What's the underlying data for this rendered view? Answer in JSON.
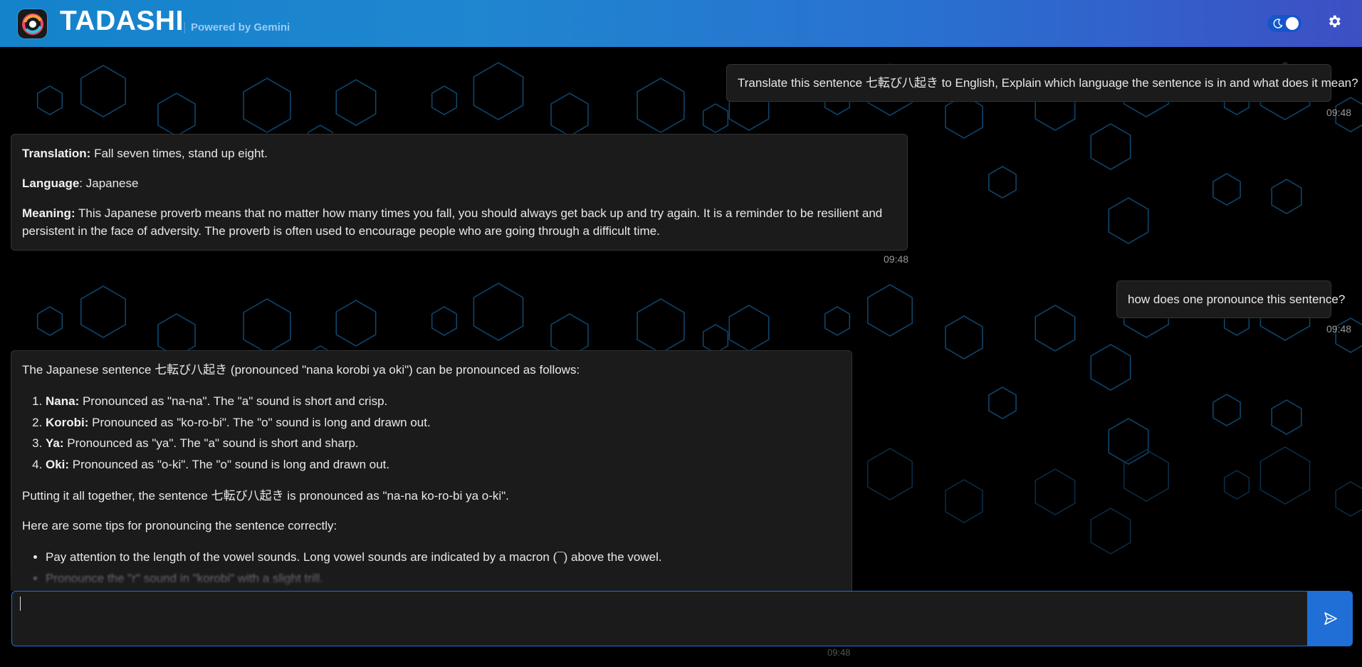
{
  "header": {
    "title": "TADASHI",
    "powered_by": "Powered by Gemini",
    "accent_color": "#1f86d0"
  },
  "messages": [
    {
      "role": "user",
      "text": "Translate this sentence 七転び八起き to English, Explain which language the sentence is in and what does it mean?",
      "time": "09:48"
    },
    {
      "role": "assistant",
      "translation_label": "Translation:",
      "translation": " Fall seven times, stand up eight.",
      "language_label": "Language",
      "language": ": Japanese",
      "meaning_label": "Meaning:",
      "meaning": " This Japanese proverb means that no matter how many times you fall, you should always get back up and try again. It is a reminder to be resilient and persistent in the face of adversity. The proverb is often used to encourage people who are going through a difficult time.",
      "time": "09:48"
    },
    {
      "role": "user",
      "text": "how does one pronounce this sentence?",
      "time": "09:48"
    },
    {
      "role": "assistant",
      "intro": "The Japanese sentence 七転び八起き (pronounced \"nana korobi ya oki\") can be pronounced as follows:",
      "steps": [
        {
          "term": "Nana:",
          "text": " Pronounced as \"na-na\". The \"a\" sound is short and crisp."
        },
        {
          "term": "Korobi:",
          "text": " Pronounced as \"ko-ro-bi\". The \"o\" sound is long and drawn out."
        },
        {
          "term": "Ya:",
          "text": " Pronounced as \"ya\". The \"a\" sound is short and sharp."
        },
        {
          "term": "Oki:",
          "text": " Pronounced as \"o-ki\". The \"o\" sound is long and drawn out."
        }
      ],
      "summary": "Putting it all together, the sentence 七転び八起き is pronounced as \"na-na ko-ro-bi ya o-ki\".",
      "tips_intro": "Here are some tips for pronouncing the sentence correctly:",
      "tips": [
        "Pay attention to the length of the vowel sounds. Long vowel sounds are indicated by a macron (¯) above the vowel.",
        "Pronounce the \"r\" sound in \"korobi\" with a slight trill."
      ],
      "time": "09:48"
    }
  ],
  "input": {
    "value": "",
    "placeholder": ""
  },
  "icons": {
    "theme": "moon-icon",
    "settings": "gear-icon",
    "send": "send-icon"
  }
}
